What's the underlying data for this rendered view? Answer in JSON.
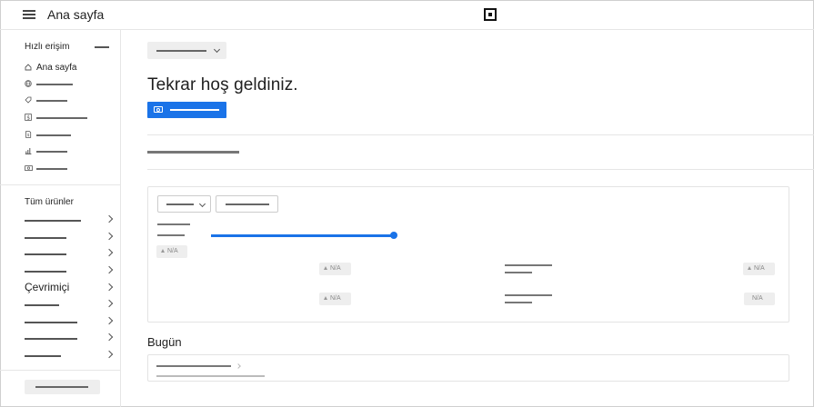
{
  "header": {
    "title": "Ana sayfa",
    "menu_icon": "hamburger-menu-icon",
    "logo_icon": "square-logo-icon"
  },
  "sidebar": {
    "quick_access_title": "Hızlı erişim",
    "quick_items": [
      {
        "label": "Ana sayfa",
        "icon": "home-icon"
      },
      {
        "label": "",
        "icon": "globe-icon"
      },
      {
        "label": "",
        "icon": "tag-icon"
      },
      {
        "label": "",
        "icon": "dollar-icon"
      },
      {
        "label": "",
        "icon": "invoice-icon"
      },
      {
        "label": "",
        "icon": "chart-icon"
      },
      {
        "label": "",
        "icon": "cash-icon"
      }
    ],
    "all_products_title": "Tüm ürünler",
    "online_label": "Çevrimiçi"
  },
  "main": {
    "welcome": "Tekrar hoş geldiniz.",
    "badge_text": "N/A",
    "today_title": "Bugün"
  },
  "colors": {
    "accent": "#1a73e8"
  }
}
